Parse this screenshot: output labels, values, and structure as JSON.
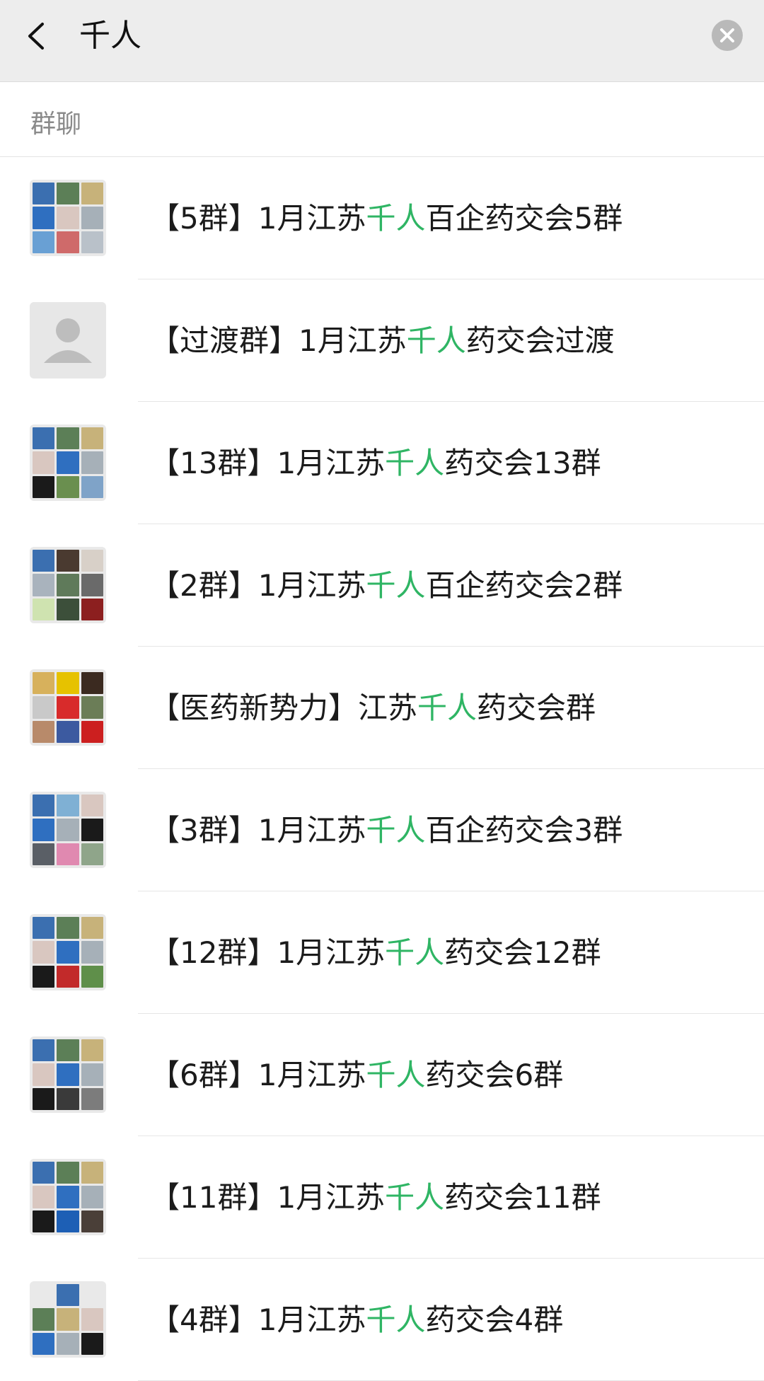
{
  "search": {
    "query": "千人"
  },
  "section": {
    "label": "群聊"
  },
  "colors": {
    "highlight": "#2fb564",
    "header_bg": "#ededed",
    "text": "#1b1b1b",
    "muted": "#8a8a8a"
  },
  "results": [
    {
      "prefix": "【5群】1月江苏",
      "highlight": "千人",
      "suffix": "百企药交会5群",
      "avatar": [
        "#3b6fb0",
        "#5c7f57",
        "#c7b27a",
        "#2f6fc0",
        "#d9c7c0",
        "#a6b0b8",
        "#69a0d4",
        "#cf6a6a",
        "#b9c1c9"
      ]
    },
    {
      "prefix": "【过渡群】1月江苏",
      "highlight": "千人",
      "suffix": "药交会过渡",
      "avatar": []
    },
    {
      "prefix": "【13群】1月江苏",
      "highlight": "千人",
      "suffix": "药交会13群",
      "avatar": [
        "#3b6fb0",
        "#5c7f57",
        "#c7b27a",
        "#d9c7c0",
        "#2f6fc0",
        "#a6b0b8",
        "#1a1a1a",
        "#6a8f4f",
        "#7fa3c8"
      ]
    },
    {
      "prefix": "【2群】1月江苏",
      "highlight": "千人",
      "suffix": "百企药交会2群",
      "avatar": [
        "#3b6fb0",
        "#4a3a30",
        "#d8d0c8",
        "#a9b3bd",
        "#5f7a5a",
        "#6a6a6a",
        "#cfe3b0",
        "#3c4f3a",
        "#8c1f1f"
      ]
    },
    {
      "prefix": "【医药新势力】江苏",
      "highlight": "千人",
      "suffix": "药交会群",
      "avatar": [
        "#d7b15c",
        "#e6c200",
        "#3b2a20",
        "#c9c9c9",
        "#d82b2b",
        "#6b7d57",
        "#b88a6a",
        "#3c5aa0",
        "#cc1f1f"
      ]
    },
    {
      "prefix": "【3群】1月江苏",
      "highlight": "千人",
      "suffix": "百企药交会3群",
      "avatar": [
        "#3b6fb0",
        "#7fb0d4",
        "#d9c7c0",
        "#2f6fc0",
        "#a6b0b8",
        "#1a1a1a",
        "#5a5f66",
        "#e089b0",
        "#8fa58a"
      ]
    },
    {
      "prefix": "【12群】1月江苏",
      "highlight": "千人",
      "suffix": "药交会12群",
      "avatar": [
        "#3b6fb0",
        "#5c7f57",
        "#c7b27a",
        "#d9c7c0",
        "#2f6fc0",
        "#a6b0b8",
        "#1a1a1a",
        "#c22a2a",
        "#5f8f4a"
      ]
    },
    {
      "prefix": "【6群】1月江苏",
      "highlight": "千人",
      "suffix": "药交会6群",
      "avatar": [
        "#3b6fb0",
        "#5c7f57",
        "#c7b27a",
        "#d9c7c0",
        "#2f6fc0",
        "#a6b0b8",
        "#1a1a1a",
        "#3a3a3a",
        "#7c7c7c"
      ]
    },
    {
      "prefix": "【11群】1月江苏",
      "highlight": "千人",
      "suffix": "药交会11群",
      "avatar": [
        "#3b6fb0",
        "#5c7f57",
        "#c7b27a",
        "#d9c7c0",
        "#2f6fc0",
        "#a6b0b8",
        "#1a1a1a",
        "#1d5fb5",
        "#4a3f38"
      ]
    },
    {
      "prefix": "【4群】1月江苏",
      "highlight": "千人",
      "suffix": "药交会4群",
      "avatar": [
        "#e9e9e9",
        "#3b6fb0",
        "#e9e9e9",
        "#5c7f57",
        "#c7b27a",
        "#d9c7c0",
        "#2f6fc0",
        "#a6b0b8",
        "#1a1a1a"
      ]
    }
  ]
}
